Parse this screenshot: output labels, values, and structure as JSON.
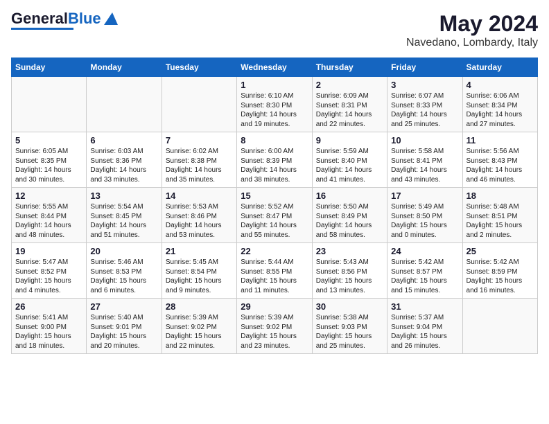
{
  "logo": {
    "text_general": "General",
    "text_blue": "Blue"
  },
  "title": "May 2024",
  "subtitle": "Navedano, Lombardy, Italy",
  "days_of_week": [
    "Sunday",
    "Monday",
    "Tuesday",
    "Wednesday",
    "Thursday",
    "Friday",
    "Saturday"
  ],
  "weeks": [
    [
      {
        "day": "",
        "content": ""
      },
      {
        "day": "",
        "content": ""
      },
      {
        "day": "",
        "content": ""
      },
      {
        "day": "1",
        "content": "Sunrise: 6:10 AM\nSunset: 8:30 PM\nDaylight: 14 hours\nand 19 minutes."
      },
      {
        "day": "2",
        "content": "Sunrise: 6:09 AM\nSunset: 8:31 PM\nDaylight: 14 hours\nand 22 minutes."
      },
      {
        "day": "3",
        "content": "Sunrise: 6:07 AM\nSunset: 8:33 PM\nDaylight: 14 hours\nand 25 minutes."
      },
      {
        "day": "4",
        "content": "Sunrise: 6:06 AM\nSunset: 8:34 PM\nDaylight: 14 hours\nand 27 minutes."
      }
    ],
    [
      {
        "day": "5",
        "content": "Sunrise: 6:05 AM\nSunset: 8:35 PM\nDaylight: 14 hours\nand 30 minutes."
      },
      {
        "day": "6",
        "content": "Sunrise: 6:03 AM\nSunset: 8:36 PM\nDaylight: 14 hours\nand 33 minutes."
      },
      {
        "day": "7",
        "content": "Sunrise: 6:02 AM\nSunset: 8:38 PM\nDaylight: 14 hours\nand 35 minutes."
      },
      {
        "day": "8",
        "content": "Sunrise: 6:00 AM\nSunset: 8:39 PM\nDaylight: 14 hours\nand 38 minutes."
      },
      {
        "day": "9",
        "content": "Sunrise: 5:59 AM\nSunset: 8:40 PM\nDaylight: 14 hours\nand 41 minutes."
      },
      {
        "day": "10",
        "content": "Sunrise: 5:58 AM\nSunset: 8:41 PM\nDaylight: 14 hours\nand 43 minutes."
      },
      {
        "day": "11",
        "content": "Sunrise: 5:56 AM\nSunset: 8:43 PM\nDaylight: 14 hours\nand 46 minutes."
      }
    ],
    [
      {
        "day": "12",
        "content": "Sunrise: 5:55 AM\nSunset: 8:44 PM\nDaylight: 14 hours\nand 48 minutes."
      },
      {
        "day": "13",
        "content": "Sunrise: 5:54 AM\nSunset: 8:45 PM\nDaylight: 14 hours\nand 51 minutes."
      },
      {
        "day": "14",
        "content": "Sunrise: 5:53 AM\nSunset: 8:46 PM\nDaylight: 14 hours\nand 53 minutes."
      },
      {
        "day": "15",
        "content": "Sunrise: 5:52 AM\nSunset: 8:47 PM\nDaylight: 14 hours\nand 55 minutes."
      },
      {
        "day": "16",
        "content": "Sunrise: 5:50 AM\nSunset: 8:49 PM\nDaylight: 14 hours\nand 58 minutes."
      },
      {
        "day": "17",
        "content": "Sunrise: 5:49 AM\nSunset: 8:50 PM\nDaylight: 15 hours\nand 0 minutes."
      },
      {
        "day": "18",
        "content": "Sunrise: 5:48 AM\nSunset: 8:51 PM\nDaylight: 15 hours\nand 2 minutes."
      }
    ],
    [
      {
        "day": "19",
        "content": "Sunrise: 5:47 AM\nSunset: 8:52 PM\nDaylight: 15 hours\nand 4 minutes."
      },
      {
        "day": "20",
        "content": "Sunrise: 5:46 AM\nSunset: 8:53 PM\nDaylight: 15 hours\nand 6 minutes."
      },
      {
        "day": "21",
        "content": "Sunrise: 5:45 AM\nSunset: 8:54 PM\nDaylight: 15 hours\nand 9 minutes."
      },
      {
        "day": "22",
        "content": "Sunrise: 5:44 AM\nSunset: 8:55 PM\nDaylight: 15 hours\nand 11 minutes."
      },
      {
        "day": "23",
        "content": "Sunrise: 5:43 AM\nSunset: 8:56 PM\nDaylight: 15 hours\nand 13 minutes."
      },
      {
        "day": "24",
        "content": "Sunrise: 5:42 AM\nSunset: 8:57 PM\nDaylight: 15 hours\nand 15 minutes."
      },
      {
        "day": "25",
        "content": "Sunrise: 5:42 AM\nSunset: 8:59 PM\nDaylight: 15 hours\nand 16 minutes."
      }
    ],
    [
      {
        "day": "26",
        "content": "Sunrise: 5:41 AM\nSunset: 9:00 PM\nDaylight: 15 hours\nand 18 minutes."
      },
      {
        "day": "27",
        "content": "Sunrise: 5:40 AM\nSunset: 9:01 PM\nDaylight: 15 hours\nand 20 minutes."
      },
      {
        "day": "28",
        "content": "Sunrise: 5:39 AM\nSunset: 9:02 PM\nDaylight: 15 hours\nand 22 minutes."
      },
      {
        "day": "29",
        "content": "Sunrise: 5:39 AM\nSunset: 9:02 PM\nDaylight: 15 hours\nand 23 minutes."
      },
      {
        "day": "30",
        "content": "Sunrise: 5:38 AM\nSunset: 9:03 PM\nDaylight: 15 hours\nand 25 minutes."
      },
      {
        "day": "31",
        "content": "Sunrise: 5:37 AM\nSunset: 9:04 PM\nDaylight: 15 hours\nand 26 minutes."
      },
      {
        "day": "",
        "content": ""
      }
    ]
  ]
}
